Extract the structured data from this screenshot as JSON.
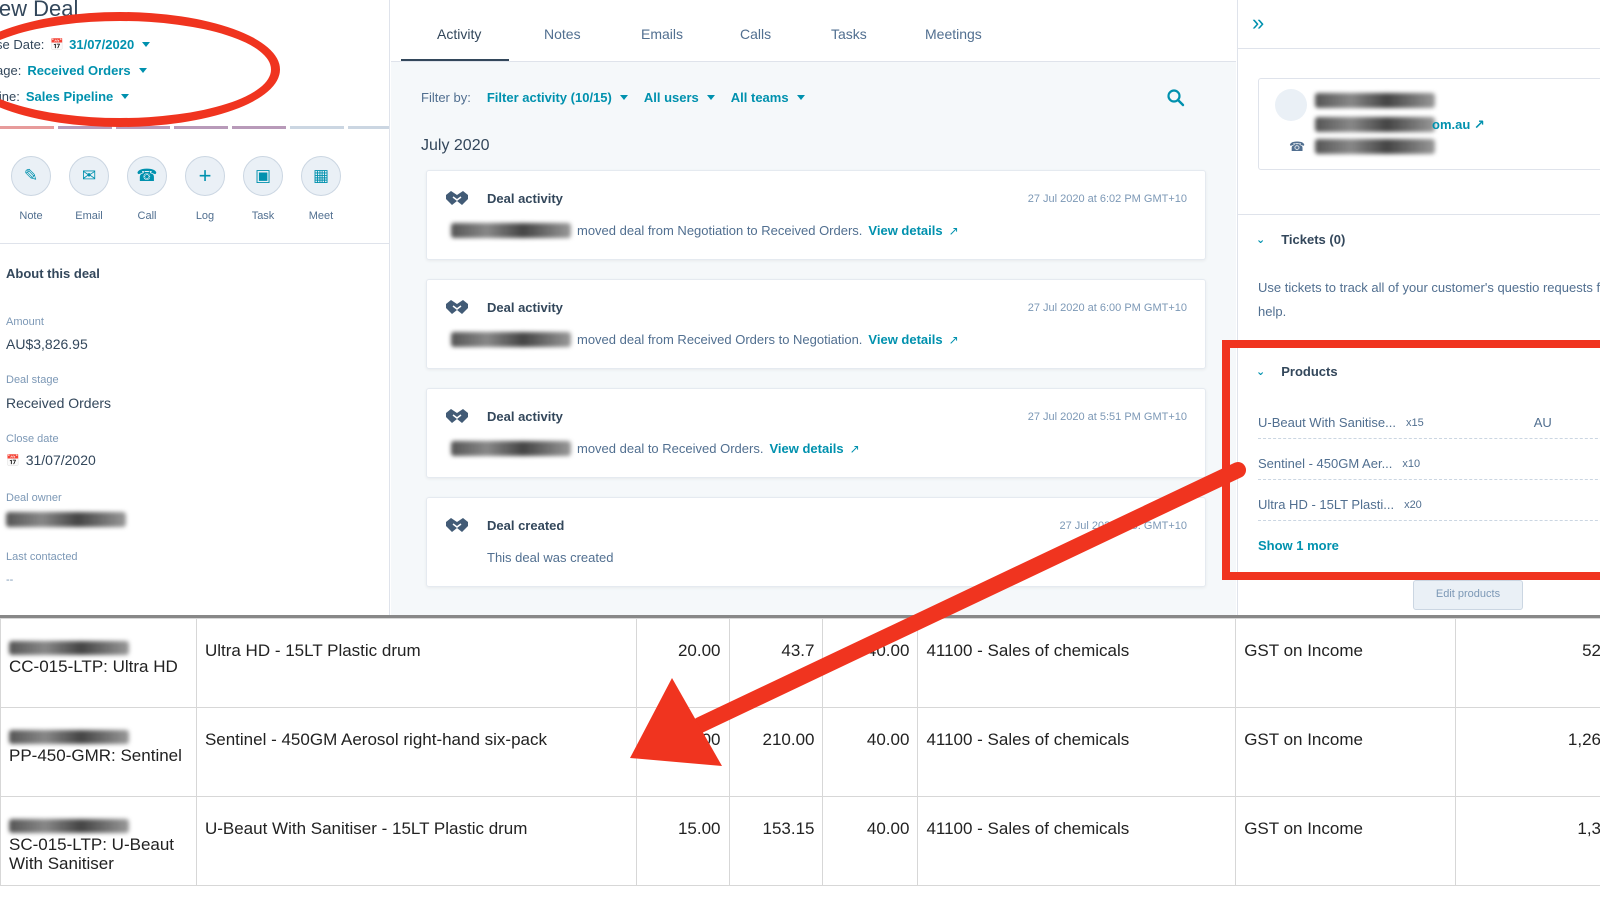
{
  "deal": {
    "title": "lew Deal",
    "close_date_label": "se Date:",
    "close_date": "31/07/2020",
    "stage_label": "age:",
    "stage": "Received Orders",
    "pipeline_label": "line:",
    "pipeline": "Sales Pipeline"
  },
  "actions": [
    {
      "label": "Note",
      "icon": "note-edit-icon"
    },
    {
      "label": "Email",
      "icon": "email-icon"
    },
    {
      "label": "Call",
      "icon": "phone-icon"
    },
    {
      "label": "Log",
      "icon": "plus-icon"
    },
    {
      "label": "Task",
      "icon": "task-icon"
    },
    {
      "label": "Meet",
      "icon": "calendar-icon"
    }
  ],
  "about": {
    "heading": "About this deal",
    "amount_label": "Amount",
    "amount": "AU$3,826.95",
    "stage_label": "Deal stage",
    "stage": "Received Orders",
    "close_label": "Close date",
    "close": "31/07/2020",
    "owner_label": "Deal owner",
    "last_contacted_label": "Last contacted",
    "last_contacted": "--"
  },
  "tabs": [
    "Activity",
    "Notes",
    "Emails",
    "Calls",
    "Tasks",
    "Meetings"
  ],
  "filter": {
    "label": "Filter by:",
    "activity": "Filter activity (10/15)",
    "users": "All users",
    "teams": "All teams"
  },
  "month": "July 2020",
  "activities": [
    {
      "title": "Deal activity",
      "time": "27 Jul 2020 at 6:02 PM GMT+10",
      "text": "moved deal from Negotiation to Received Orders.",
      "link": "View details"
    },
    {
      "title": "Deal activity",
      "time": "27 Jul 2020 at 6:00 PM GMT+10",
      "text": "moved deal from Received Orders to Negotiation.",
      "link": "View details"
    },
    {
      "title": "Deal activity",
      "time": "27 Jul 2020 at 5:51 PM GMT+10",
      "text": "moved deal to Received Orders.",
      "link": "View details"
    },
    {
      "title": "Deal created",
      "time": "27 Jul 2020 at 5:  GMT+10",
      "text": "This deal was created",
      "link": ""
    }
  ],
  "right": {
    "email_suffix": "om.au",
    "tickets_heading": "Tickets (0)",
    "tickets_text": "Use tickets to track all of your customer's questio requests for help.",
    "products_heading": "Products",
    "products": [
      {
        "name": "U-Beaut With Sanitise...",
        "qty": "x15",
        "extra": "AU"
      },
      {
        "name": "Sentinel - 450GM Aer...",
        "qty": "x10",
        "extra": ""
      },
      {
        "name": "Ultra HD - 15LT Plasti...",
        "qty": "x20",
        "extra": ""
      }
    ],
    "show_more": "Show 1 more",
    "edit_products": "Edit products"
  },
  "table_rows": [
    {
      "code": "CC-015-LTP: Ultra HD",
      "desc": "Ultra HD - 15LT Plastic drum",
      "qty": "20.00",
      "price": "43.7",
      "disc": "40.00",
      "account": "41100 - Sales of chemicals",
      "tax": "GST on Income",
      "amount": "52"
    },
    {
      "code": "PP-450-GMR: Sentinel",
      "desc": "Sentinel - 450GM Aerosol right-hand six-pack",
      "qty": "00",
      "price": "210.00",
      "disc": "40.00",
      "account": "41100 - Sales of chemicals",
      "tax": "GST on Income",
      "amount": "1,26"
    },
    {
      "code": "SC-015-LTP: U-Beaut With Sanitiser",
      "desc": "U-Beaut With Sanitiser - 15LT Plastic drum",
      "qty": "15.00",
      "price": "153.15",
      "disc": "40.00",
      "account": "41100 - Sales of chemicals",
      "tax": "GST on Income",
      "amount": "1,3"
    }
  ],
  "colors": {
    "accent": "#0091ae",
    "annotation": "#f0341f",
    "text": "#33475b"
  }
}
